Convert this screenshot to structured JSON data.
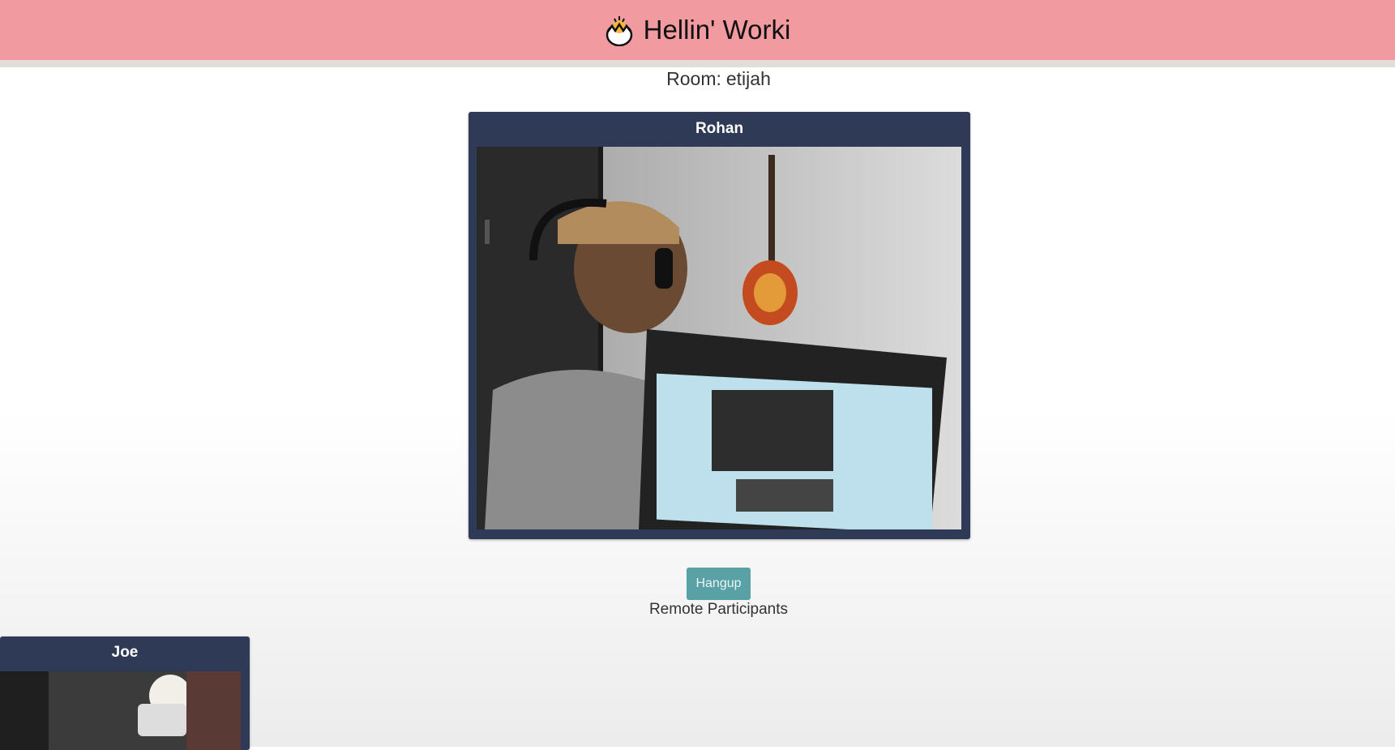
{
  "header": {
    "title": "Hellin' Worki",
    "logo_icon": "hatching-chick-icon"
  },
  "room": {
    "label": "Room:",
    "name": "etijah"
  },
  "participants": {
    "local": {
      "name": "Rohan"
    },
    "remote": [
      {
        "name": "Joe"
      }
    ]
  },
  "controls": {
    "hangup_label": "Hangup",
    "remote_heading": "Remote Participants"
  },
  "colors": {
    "topbar": "#f19aa0",
    "tile": "#2e3a56",
    "hangup": "#5aa1a6"
  }
}
